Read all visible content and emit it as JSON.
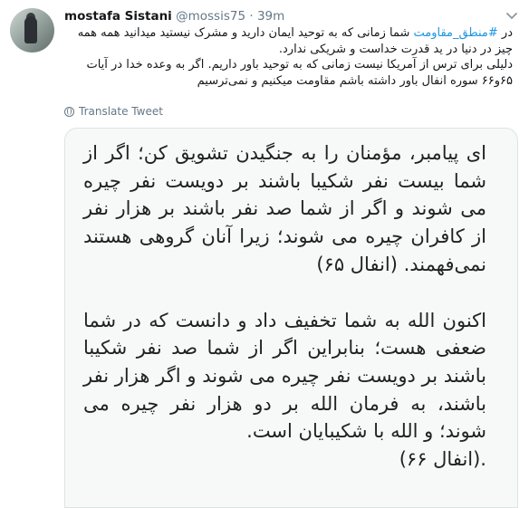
{
  "author": {
    "name": "mostafa Sistani",
    "handle": "@mossis75",
    "separator": "·",
    "time": "39m"
  },
  "tweet": {
    "line1_prefix": "در ",
    "hashtag": "#منطق_مقاومت",
    "line1_rest": " شما زمانی که به توحید ایمان دارید و مشرک نیستید میدانید همه همه چیز در دنیا در ید قدرت خداست و شریکی ندارد.",
    "line2": "دلیلی برای ترس از آمریکا نیست زمانی که به توحید باور داریم. اگر به وعده خدا در آیات ۶۵و۶۶ سوره انفال باور داشته باشم مقاومت میکنیم و نمی‌ترسیم"
  },
  "translate": {
    "label": "Translate Tweet",
    "icon": "globe-icon"
  },
  "image_text": {
    "para1": "ای پیامبر، مؤمنان را به جنگیدن تشویق کن؛ اگر از شما بیست نفر شکیبا باشند بر دویست نفر چیره می شوند و اگر از شما صد نفر باشند بر هزار نفر از کافران چیره می شوند؛ زیرا آنان گروهی هستند نمی‌فهمند. (انفال ۶۵)",
    "para2": "اکنون الله به شما تخفیف داد و دانست که در شما ضعفی هست؛ بنابراین اگر از شما صد نفر شکیبا باشند بر دویست نفر چیره می شوند و اگر هزار نفر باشند، به فرمان الله بر دو هزار نفر چیره می شوند؛ و الله با شکیبایان است.",
    "para2_ref": ".(انفال ۶۶)"
  },
  "colors": {
    "link": "#1b95e0",
    "muted": "#657786",
    "text": "#14171a",
    "media_bg": "#f7f9f9"
  }
}
